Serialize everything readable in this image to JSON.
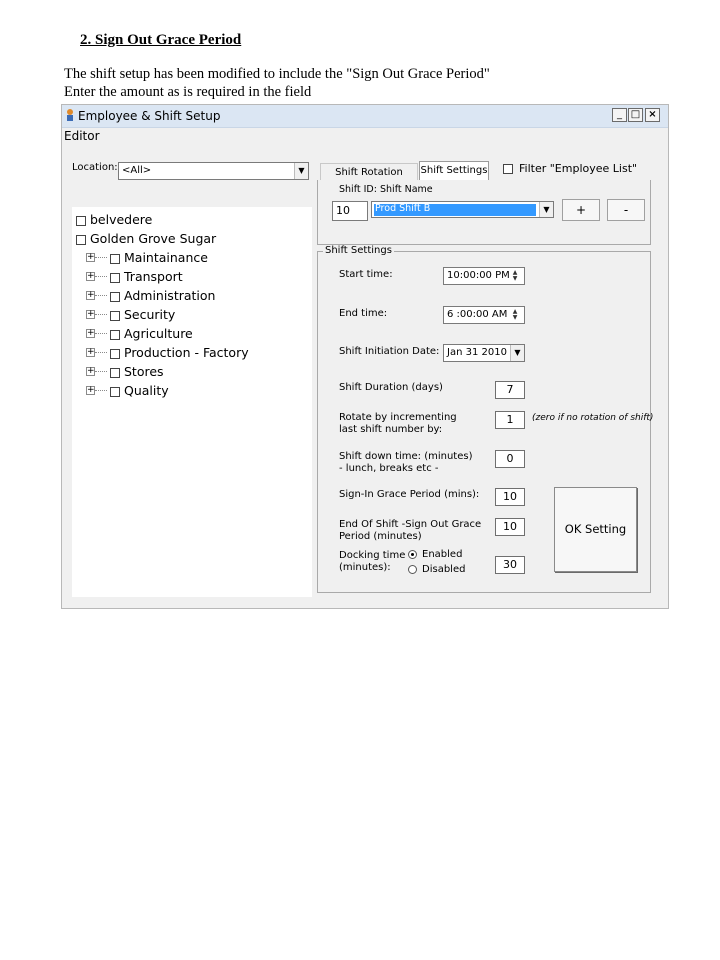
{
  "doc": {
    "heading": "2.  Sign Out Grace Period",
    "line1": "The shift setup has been modified to include the \"Sign Out Grace Period\"",
    "line2": "Enter the amount as is required in the field"
  },
  "window": {
    "title": "Employee & Shift Setup",
    "controls": {
      "minimize": "_",
      "maximize": "□",
      "close": "×"
    },
    "menu": "Editor"
  },
  "location": {
    "label": "Location:",
    "value": "<All>"
  },
  "tree": {
    "roots": [
      "belvedere",
      "Golden Grove Sugar"
    ],
    "children": [
      "Maintainance",
      "Transport",
      "Administration",
      "Security",
      "Agriculture",
      "Production - Factory",
      "Stores",
      "Quality"
    ]
  },
  "tabs": {
    "roster": "Shift Rotation Roster",
    "settings": "Shift Settings"
  },
  "filter": {
    "label": "Filter \"Employee List\""
  },
  "shift": {
    "id_label": "Shift ID:",
    "name_label": "Shift Name",
    "id_value": "10",
    "name_value": "Prod Shift B",
    "add_label": "+",
    "remove_label": "-"
  },
  "settings": {
    "group_title": "Shift Settings",
    "start_label": "Start time:",
    "start_value": "10:00:00 PM",
    "end_label": "End time:",
    "end_value": "6 :00:00 AM",
    "init_label": "Shift Initiation Date:",
    "init_value": "Jan 31 2010",
    "duration_label": "Shift Duration (days)",
    "duration_value": "7",
    "rotate_label_1": "Rotate by incrementing",
    "rotate_label_2": "last shift number by:",
    "rotate_value": "1",
    "rotate_note": "(zero if no rotation of shift)",
    "down_label_1": "Shift down time: (minutes)",
    "down_label_2": "- lunch, breaks etc -",
    "down_value": "0",
    "signin_label": "Sign-In Grace Period (mins):",
    "signin_value": "10",
    "signout_label_1": "End Of Shift -Sign Out Grace",
    "signout_label_2": "Period   (minutes)",
    "signout_value": "10",
    "docking_label_1": "Docking time",
    "docking_label_2": "(minutes):",
    "enabled_label": "Enabled",
    "disabled_label": "Disabled",
    "docking_value": "30",
    "ok_label": "OK Setting"
  }
}
